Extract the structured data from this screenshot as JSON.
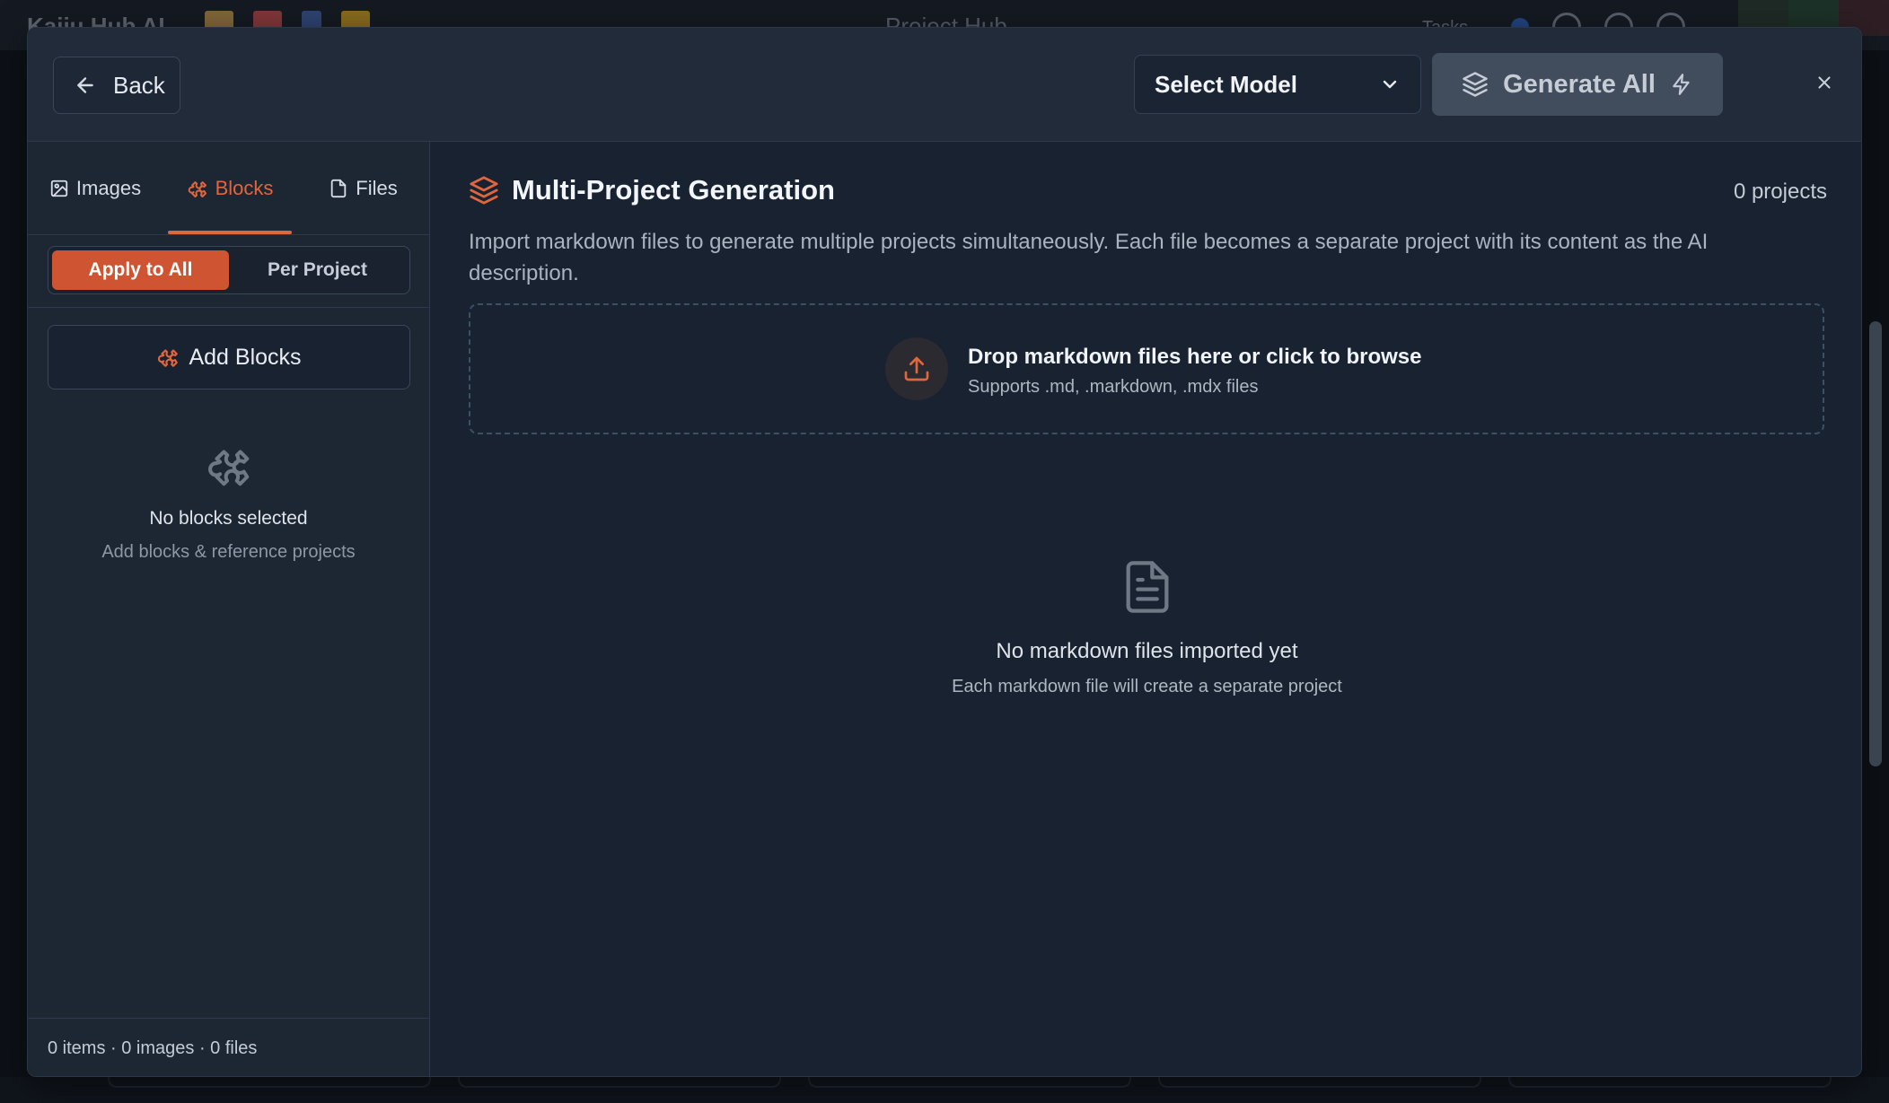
{
  "app": {
    "title": "Kaiju Hub AI",
    "center_title": "Project Hub",
    "tasks_label": "Tasks ⌄"
  },
  "header": {
    "back_label": "Back",
    "model_select": {
      "selected": "Select Model"
    },
    "generate_label": "Generate All"
  },
  "sidebar": {
    "tabs": [
      {
        "label": "Images",
        "icon": "image-icon",
        "active": false
      },
      {
        "label": "Blocks",
        "icon": "puzzle-icon",
        "active": true
      },
      {
        "label": "Files",
        "icon": "file-icon",
        "active": false
      }
    ],
    "scope_toggle": {
      "options": [
        "Apply to All",
        "Per Project"
      ],
      "selected": "Apply to All"
    },
    "add_blocks_label": "Add Blocks",
    "empty_state": {
      "title": "No blocks selected",
      "subtitle": "Add blocks & reference projects"
    },
    "footer": "0 items · 0 images · 0 files"
  },
  "main": {
    "title": "Multi-Project Generation",
    "project_count": "0 projects",
    "description": "Import markdown files to generate multiple projects simultaneously. Each file becomes a separate project with its content as the AI description.",
    "drop_zone": {
      "title": "Drop markdown files here or click to browse",
      "subtitle": "Supports .md, .markdown, .mdx files"
    },
    "empty_state": {
      "title": "No markdown files imported yet",
      "subtitle": "Each markdown file will create a separate project"
    }
  },
  "colors": {
    "accent": "#e0663d",
    "accent_button": "#cf5532",
    "modal_bg": "#1a2331",
    "header_bg": "#212b3a",
    "generate_disabled": "#414c5c"
  }
}
